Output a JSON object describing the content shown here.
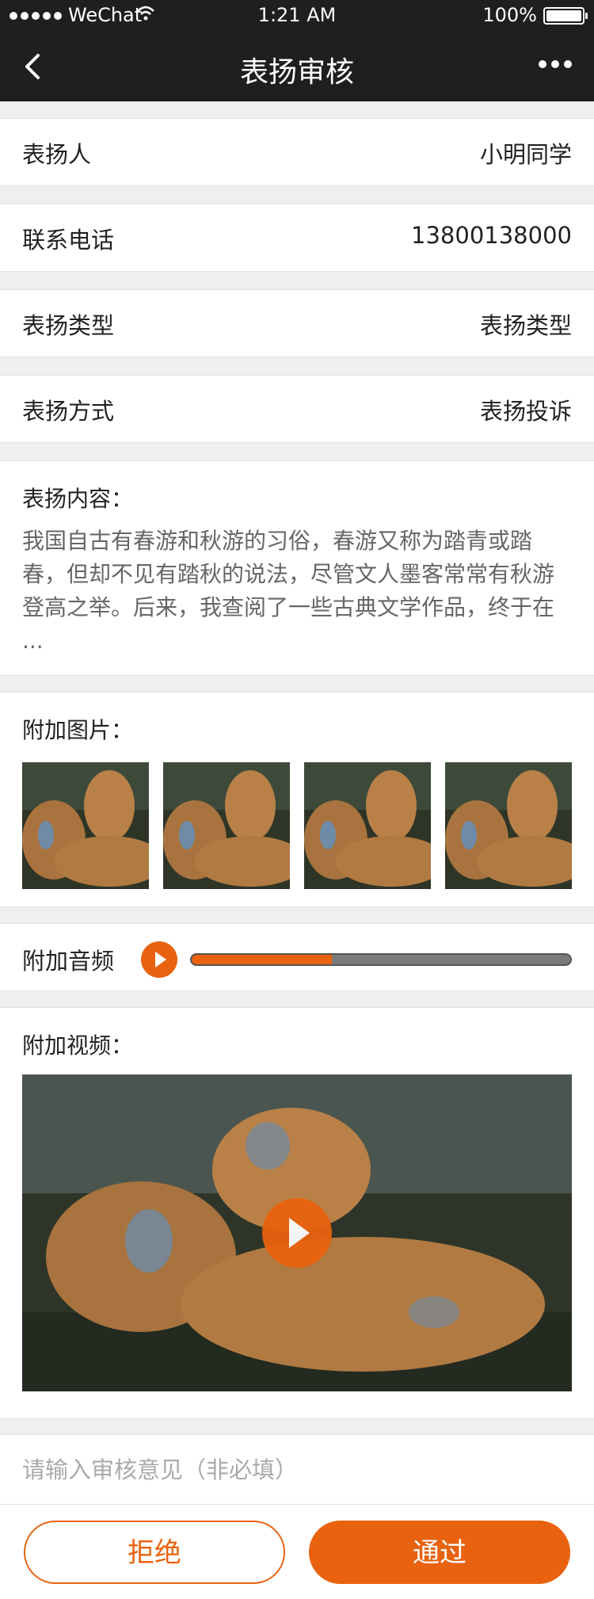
{
  "status_bar": {
    "carrier": "WeChat",
    "time": "1:21 AM",
    "battery": "100%"
  },
  "nav": {
    "title": "表扬审核"
  },
  "fields": [
    {
      "label": "表扬人",
      "value": "小明同学"
    },
    {
      "label": "联系电话",
      "value": "13800138000"
    },
    {
      "label": "表扬类型",
      "value": "表扬类型"
    },
    {
      "label": "表扬方式",
      "value": "表扬投诉"
    }
  ],
  "content": {
    "label": "表扬内容：",
    "text": "我国自古有春游和秋游的习俗，春游又称为踏青或踏春，但却不见有踏秋的说法，尽管文人墨客常常有秋游登高之举。后来，我查阅了一些古典文学作品，终于在 ..."
  },
  "images": {
    "label": "附加图片：",
    "count": 4
  },
  "audio": {
    "label": "附加音频",
    "progress": 0.37
  },
  "video": {
    "label": "附加视频："
  },
  "opinion": {
    "placeholder": "请输入审核意见（非必填）"
  },
  "actions": {
    "reject": "拒绝",
    "pass": "通过"
  },
  "colors": {
    "accent": "#e8620f",
    "header": "#1f1f1f"
  }
}
